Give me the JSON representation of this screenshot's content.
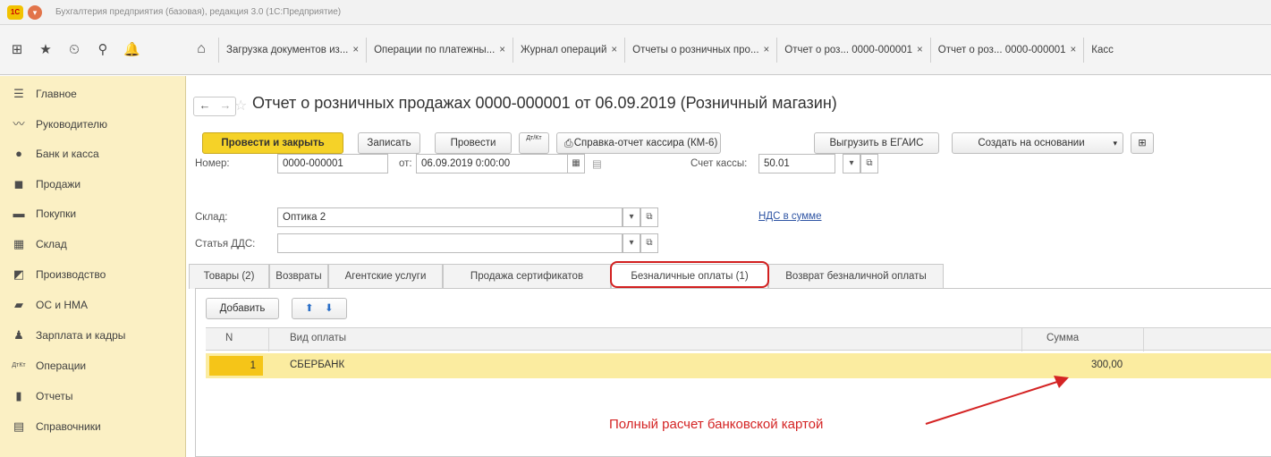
{
  "window": {
    "title": "Бухгалтерия предприятия (базовая), редакция 3.0 (1С:Предприятие)",
    "logo": "1С"
  },
  "toolbar": {
    "icons": [
      "grid-icon",
      "star-icon",
      "history-icon",
      "search-icon",
      "bell-icon"
    ]
  },
  "tabs": [
    {
      "label": "Загрузка документов из...",
      "closable": true
    },
    {
      "label": "Операции по платежны...",
      "closable": true
    },
    {
      "label": "Журнал операций",
      "closable": true
    },
    {
      "label": "Отчеты о розничных про...",
      "closable": true
    },
    {
      "label": "Отчет о роз... 0000-000001",
      "closable": true
    },
    {
      "label": "Отчет о роз... 0000-000001",
      "closable": true
    },
    {
      "label": "Касс",
      "closable": false
    }
  ],
  "sidebar": {
    "items": [
      {
        "label": "Главное",
        "icon": "menu-icon",
        "glyph": "☰"
      },
      {
        "label": "Руководителю",
        "icon": "trend-icon",
        "glyph": "〰"
      },
      {
        "label": "Банк и касса",
        "icon": "coin-icon",
        "glyph": "●"
      },
      {
        "label": "Продажи",
        "icon": "cart-icon",
        "glyph": "◼"
      },
      {
        "label": "Покупки",
        "icon": "basket-icon",
        "glyph": "▬"
      },
      {
        "label": "Склад",
        "icon": "warehouse-icon",
        "glyph": "▦"
      },
      {
        "label": "Производство",
        "icon": "factory-icon",
        "glyph": "◩"
      },
      {
        "label": "ОС и НМА",
        "icon": "truck-icon",
        "glyph": "▰"
      },
      {
        "label": "Зарплата и кадры",
        "icon": "person-icon",
        "glyph": "♟"
      },
      {
        "label": "Операции",
        "icon": "operations-icon",
        "glyph": "ДтКт"
      },
      {
        "label": "Отчеты",
        "icon": "chart-icon",
        "glyph": "▮"
      },
      {
        "label": "Справочники",
        "icon": "book-icon",
        "glyph": "▤"
      }
    ]
  },
  "form": {
    "title": "Отчет о розничных продажах 0000-000001 от 06.09.2019 (Розничный магазин)",
    "buttons": {
      "post_close": "Провести и закрыть",
      "save": "Записать",
      "post": "Провести",
      "dtkt": "Дт/Кт",
      "cashier_report": "Справка-отчет кассира (КМ-6)",
      "egais": "Выгрузить в ЕГАИС",
      "create_based": "Создать на основании"
    },
    "fields": {
      "number_label": "Номер:",
      "number_value": "0000-000001",
      "date_label": "от:",
      "date_value": "06.09.2019 0:00:00",
      "cash_account_label": "Счет кассы:",
      "cash_account_value": "50.01",
      "warehouse_label": "Склад:",
      "warehouse_value": "Оптика 2",
      "vat_link": "НДС в сумме",
      "dds_label": "Статья ДДС:",
      "dds_value": ""
    },
    "inner_tabs": [
      "Товары (2)",
      "Возвраты",
      "Агентские услуги",
      "Продажа сертификатов",
      "Безналичные оплаты (1)",
      "Возврат безналичной оплаты"
    ],
    "active_inner_tab": "Безналичные оплаты (1)",
    "table": {
      "add_button": "Добавить",
      "columns": [
        "N",
        "Вид оплаты",
        "Сумма"
      ],
      "rows": [
        {
          "n": "1",
          "payment_type": "СБЕРБАНК",
          "amount": "300,00"
        }
      ]
    }
  },
  "annotation": {
    "text": "Полный расчет банковской картой",
    "color": "#d42424"
  },
  "colors": {
    "sidebar_bg": "#fbf0c4",
    "primary_button": "#f5d228",
    "selected_row": "#fbeca0",
    "highlight": "#d21f1f"
  }
}
